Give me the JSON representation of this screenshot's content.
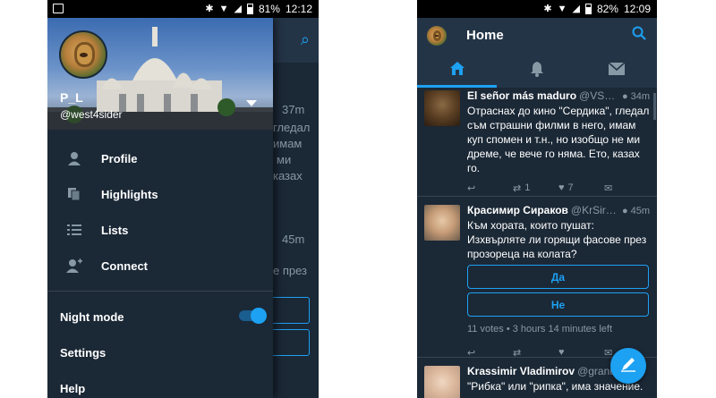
{
  "left": {
    "status": {
      "bluetooth": "bluetooth-icon",
      "battery": "81%",
      "time": "12:12"
    },
    "background_peek": {
      "texts": [
        "37m",
        "гледал",
        "имам",
        "ми",
        "казах",
        "45m",
        "е през"
      ]
    },
    "drawer": {
      "profile": {
        "name": "P_L",
        "handle": "@west4sider"
      },
      "menu": [
        {
          "label": "Profile",
          "icon": "person-icon"
        },
        {
          "label": "Highlights",
          "icon": "highlights-icon"
        },
        {
          "label": "Lists",
          "icon": "lists-icon"
        },
        {
          "label": "Connect",
          "icon": "add-person-icon"
        }
      ],
      "night_mode": {
        "label": "Night mode",
        "on": true
      },
      "settings_label": "Settings",
      "help_label": "Help"
    }
  },
  "right": {
    "status": {
      "bluetooth": "bluetooth-icon",
      "battery": "82%",
      "time": "12:09"
    },
    "header": {
      "title": "Home"
    },
    "tabs": [
      {
        "icon": "home-icon",
        "active": true
      },
      {
        "icon": "bell-icon",
        "active": false
      },
      {
        "icon": "mail-icon",
        "active": false
      }
    ],
    "tweets": [
      {
        "name": "El señor más maduro",
        "handle": "@VSchw...",
        "time": "34m",
        "text": "Отраснах до кино \"Сердика\", гледал съм страшни филми в него, имам куп спомен и т.н., но изобщо не ми дреме, че вече го няма. Ето, казах го.",
        "retweets": "1",
        "likes": "7"
      },
      {
        "name": "Красимир Сираков",
        "handle": "@KrSirakov",
        "time": "45m",
        "text": "Към хората, които пушат: Изхвърляте ли горящи фасове през прозореца на колата?",
        "poll_options": [
          "Да",
          "Не"
        ],
        "poll_meta": "11 votes • 3 hours 14 minutes left"
      },
      {
        "name": "Krassimir Vladimirov",
        "handle": "@granula",
        "text": "\"Рибка\" или \"рипка\", има значение."
      }
    ]
  }
}
